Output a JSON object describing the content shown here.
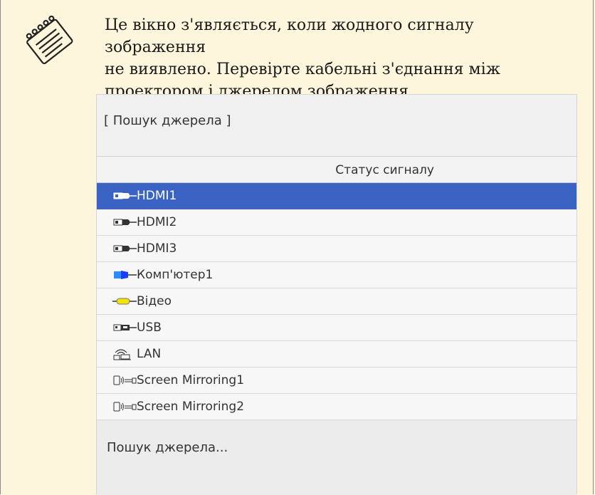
{
  "note": {
    "text_line1": "Це вікно з'являється, коли жодного сигналу зображення",
    "text_line2": "не виявлено. Перевірте кабельні з'єднання між",
    "text_line3": "проектором і джерелом зображення.",
    "icon": "note-pad-icon"
  },
  "panel": {
    "title": "[ Пошук джерела ]",
    "column_header": "Статус сигналу",
    "sources": [
      {
        "label": "HDMI1",
        "icon": "hdmi-icon",
        "selected": true
      },
      {
        "label": "HDMI2",
        "icon": "hdmi-icon",
        "selected": false
      },
      {
        "label": "HDMI3",
        "icon": "hdmi-icon",
        "selected": false
      },
      {
        "label": "Комп'ютер1",
        "icon": "computer-vga-icon",
        "selected": false
      },
      {
        "label": "Відео",
        "icon": "video-rca-icon",
        "selected": false
      },
      {
        "label": "USB",
        "icon": "usb-icon",
        "selected": false
      },
      {
        "label": "LAN",
        "icon": "lan-icon",
        "selected": false
      },
      {
        "label": "Screen Mirroring1",
        "icon": "screen-mirroring-icon",
        "selected": false
      },
      {
        "label": "Screen Mirroring2",
        "icon": "screen-mirroring-icon",
        "selected": false
      }
    ],
    "footer": "Пошук джерела..."
  },
  "colors": {
    "note_bg": "#fdf5dc",
    "selection": "#3a63c3",
    "vga_blue": "#1a3cff",
    "video_yellow": "#f0e400"
  }
}
